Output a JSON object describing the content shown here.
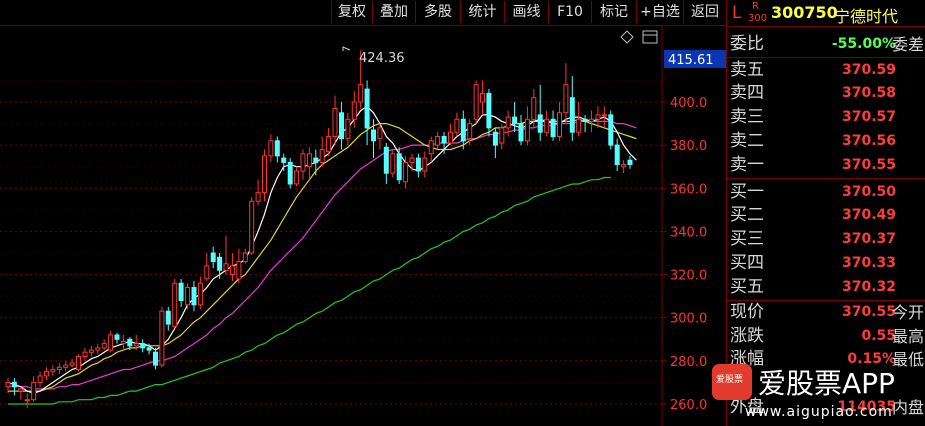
{
  "toolbar": {
    "buttons": [
      "复权",
      "叠加",
      "多股",
      "统计",
      "画线",
      "F10",
      "标记",
      "+自选",
      "返回"
    ]
  },
  "stock": {
    "market_tag": "L",
    "r_tag": "R",
    "index_tag": "300",
    "code": "300750",
    "name": "宁德时代"
  },
  "chart": {
    "high_marker": "424.36",
    "price_label": "415.61",
    "y_ticks": [
      "400.0",
      "380.0",
      "360.0",
      "340.0",
      "320.0",
      "300.0",
      "280.0",
      "260.0"
    ]
  },
  "chart_data": {
    "type": "candlestick",
    "y_tick_values": [
      400,
      380,
      360,
      340,
      320,
      300,
      280,
      260
    ],
    "high_annotation": 424.36,
    "candles": [
      [
        268,
        270,
        265,
        272
      ],
      [
        270,
        268,
        264,
        272
      ],
      [
        266,
        267,
        262,
        268
      ],
      [
        262,
        262,
        258,
        265
      ],
      [
        262,
        270,
        261,
        273
      ],
      [
        270,
        273,
        268,
        275
      ],
      [
        273,
        275,
        271,
        277
      ],
      [
        275,
        276,
        273,
        278
      ],
      [
        276,
        277,
        274,
        279
      ],
      [
        277,
        278,
        275,
        280
      ],
      [
        278,
        279,
        277,
        281
      ],
      [
        276,
        282,
        275,
        283
      ],
      [
        282,
        284,
        280,
        286
      ],
      [
        284,
        285,
        282,
        287
      ],
      [
        285,
        286,
        283,
        288
      ],
      [
        286,
        288,
        285,
        290
      ],
      [
        285,
        292,
        284,
        294
      ],
      [
        292,
        290,
        288,
        293
      ],
      [
        288,
        289,
        285,
        292
      ],
      [
        290,
        287,
        285,
        291
      ],
      [
        287,
        288,
        285,
        292
      ],
      [
        288,
        286,
        284,
        290
      ],
      [
        286,
        285,
        283,
        288
      ],
      [
        284,
        278,
        276,
        286
      ],
      [
        278,
        303,
        277,
        305
      ],
      [
        303,
        297,
        294,
        305
      ],
      [
        296,
        316,
        295,
        318
      ],
      [
        316,
        308,
        305,
        318
      ],
      [
        306,
        314,
        304,
        316
      ],
      [
        314,
        306,
        303,
        317
      ],
      [
        306,
        316,
        304,
        319
      ],
      [
        318,
        324,
        317,
        330
      ],
      [
        330,
        326,
        323,
        333
      ],
      [
        328,
        322,
        318,
        330
      ],
      [
        322,
        325,
        320,
        338
      ],
      [
        320,
        324,
        317,
        330
      ],
      [
        318,
        326,
        316,
        332
      ],
      [
        326,
        330,
        325,
        332
      ],
      [
        330,
        354,
        329,
        356
      ],
      [
        354,
        358,
        352,
        364
      ],
      [
        358,
        375,
        354,
        378
      ],
      [
        375,
        382,
        372,
        385
      ],
      [
        382,
        375,
        372,
        384
      ],
      [
        374,
        372,
        368,
        376
      ],
      [
        372,
        362,
        360,
        374
      ],
      [
        362,
        368,
        361,
        370
      ],
      [
        368,
        376,
        364,
        378
      ],
      [
        370,
        376,
        364,
        379
      ],
      [
        374,
        372,
        366,
        378
      ],
      [
        372,
        378,
        370,
        384
      ],
      [
        377,
        384,
        375,
        388
      ],
      [
        384,
        397,
        380,
        403
      ],
      [
        395,
        383,
        378,
        400
      ],
      [
        383,
        392,
        380,
        395
      ],
      [
        392,
        400,
        388,
        405
      ],
      [
        400,
        408,
        397,
        424
      ],
      [
        406,
        388,
        380,
        410
      ],
      [
        387,
        382,
        374,
        392
      ],
      [
        383,
        388,
        378,
        390
      ],
      [
        379,
        367,
        362,
        381
      ],
      [
        367,
        376,
        365,
        378
      ],
      [
        376,
        364,
        362,
        379
      ],
      [
        363,
        372,
        360,
        375
      ],
      [
        372,
        374,
        368,
        376
      ],
      [
        374,
        368,
        365,
        376
      ],
      [
        368,
        374,
        365,
        377
      ],
      [
        376,
        382,
        372,
        384
      ],
      [
        380,
        384,
        378,
        386
      ],
      [
        384,
        381,
        376,
        386
      ],
      [
        381,
        386,
        380,
        390
      ],
      [
        386,
        392,
        384,
        395
      ],
      [
        392,
        382,
        378,
        396
      ],
      [
        383,
        390,
        380,
        392
      ],
      [
        392,
        408,
        390,
        410
      ],
      [
        400,
        404,
        394,
        410
      ],
      [
        404,
        388,
        384,
        406
      ],
      [
        386,
        380,
        374,
        388
      ],
      [
        381,
        388,
        378,
        390
      ],
      [
        388,
        393,
        384,
        396
      ],
      [
        393,
        390,
        386,
        400
      ],
      [
        390,
        382,
        380,
        394
      ],
      [
        382,
        392,
        380,
        398
      ],
      [
        392,
        402,
        388,
        406
      ],
      [
        394,
        386,
        382,
        408
      ],
      [
        386,
        392,
        384,
        396
      ],
      [
        392,
        384,
        382,
        396
      ],
      [
        384,
        395,
        382,
        400
      ],
      [
        395,
        408,
        390,
        418
      ],
      [
        402,
        386,
        382,
        412
      ],
      [
        386,
        392,
        384,
        400
      ],
      [
        392,
        391,
        386,
        394
      ],
      [
        391,
        392,
        386,
        396
      ],
      [
        392,
        394,
        388,
        398
      ],
      [
        394,
        394,
        388,
        398
      ],
      [
        394,
        380,
        378,
        396
      ],
      [
        380,
        371,
        368,
        383
      ],
      [
        370,
        371,
        367,
        373
      ],
      [
        373,
        371,
        369,
        375
      ]
    ],
    "ma5": [
      270,
      269,
      268,
      266,
      265,
      266,
      268,
      270,
      272,
      274,
      276,
      277,
      279,
      281,
      282,
      284,
      286,
      287,
      288,
      289,
      288,
      288,
      287,
      285,
      287,
      290,
      295,
      300,
      306,
      309,
      311,
      314,
      318,
      320,
      322,
      324,
      325,
      327,
      333,
      340,
      348,
      358,
      365,
      370,
      371,
      370,
      370,
      371,
      372,
      374,
      376,
      381,
      386,
      388,
      392,
      396,
      398,
      395,
      390,
      384,
      381,
      376,
      372,
      369,
      368,
      370,
      372,
      375,
      378,
      381,
      384,
      386,
      388,
      390,
      394,
      394,
      393,
      391,
      390,
      389,
      388,
      389,
      391,
      392,
      391,
      390,
      390,
      392,
      393,
      393,
      392,
      391,
      392,
      393,
      391,
      386,
      380,
      376,
      373
    ],
    "ma10": [
      266,
      266,
      266,
      266,
      266,
      266,
      267,
      268,
      270,
      272,
      273,
      274,
      276,
      278,
      279,
      281,
      282,
      284,
      285,
      286,
      286,
      287,
      287,
      287,
      287,
      288,
      290,
      292,
      295,
      298,
      300,
      303,
      306,
      309,
      312,
      315,
      318,
      320,
      324,
      328,
      332,
      336,
      341,
      346,
      351,
      356,
      360,
      364,
      368,
      371,
      373,
      375,
      377,
      379,
      382,
      385,
      387,
      389,
      390,
      390,
      389,
      388,
      386,
      384,
      382,
      380,
      379,
      378,
      378,
      378,
      379,
      380,
      382,
      383,
      385,
      386,
      388,
      388,
      389,
      390,
      390,
      391,
      391,
      391,
      391,
      391,
      391,
      391,
      391,
      392,
      391,
      390,
      389,
      388,
      387,
      386,
      385,
      384,
      383
    ],
    "ma20": [
      268,
      268,
      268,
      268,
      267,
      267,
      267,
      267,
      268,
      268,
      269,
      269,
      270,
      271,
      272,
      273,
      274,
      275,
      276,
      276,
      277,
      278,
      279,
      280,
      280,
      281,
      282,
      284,
      286,
      288,
      290,
      292,
      295,
      297,
      300,
      302,
      305,
      308,
      311,
      314,
      318,
      322,
      325,
      328,
      331,
      334,
      337,
      341,
      345,
      349,
      353,
      357,
      360,
      363,
      366,
      369,
      371,
      373,
      375,
      377,
      378,
      378,
      379,
      380,
      380,
      380,
      380,
      381,
      381,
      381,
      381,
      382,
      383,
      383,
      384,
      385,
      385,
      386,
      386,
      387,
      387,
      388,
      388,
      389,
      389,
      389,
      390,
      390,
      390,
      391,
      391,
      391,
      391,
      391,
      391,
      390,
      390,
      389,
      388
    ],
    "ma60": [
      260,
      260,
      260,
      260,
      260,
      260,
      260,
      260,
      261,
      261,
      261,
      262,
      262,
      262,
      263,
      263,
      264,
      264,
      265,
      266,
      266,
      267,
      268,
      269,
      269,
      270,
      271,
      272,
      273,
      274,
      275,
      276,
      277,
      279,
      280,
      281,
      282,
      284,
      285,
      287,
      288,
      290,
      292,
      293,
      295,
      297,
      298,
      300,
      302,
      303,
      305,
      307,
      308,
      310,
      312,
      313,
      315,
      317,
      318,
      320,
      322,
      323,
      325,
      327,
      328,
      330,
      332,
      333,
      335,
      336,
      338,
      340,
      341,
      343,
      344,
      346,
      347,
      349,
      350,
      352,
      353,
      354,
      356,
      357,
      358,
      359,
      360,
      361,
      362,
      362,
      363,
      364,
      364,
      365,
      365
    ]
  },
  "panel": {
    "wei_bi": {
      "label": "委比",
      "value": "-55.00%",
      "extra": "委差"
    },
    "sells": [
      {
        "label": "卖五",
        "price": "370.59"
      },
      {
        "label": "卖四",
        "price": "370.58"
      },
      {
        "label": "卖三",
        "price": "370.57"
      },
      {
        "label": "卖二",
        "price": "370.56"
      },
      {
        "label": "卖一",
        "price": "370.55"
      }
    ],
    "buys": [
      {
        "label": "买一",
        "price": "370.50"
      },
      {
        "label": "买二",
        "price": "370.49"
      },
      {
        "label": "买三",
        "price": "370.37"
      },
      {
        "label": "买四",
        "price": "370.33"
      },
      {
        "label": "买五",
        "price": "370.32"
      }
    ],
    "quote": [
      {
        "label": "现价",
        "value": "370.55",
        "extra": "今开"
      },
      {
        "label": "涨跌",
        "value": "0.55",
        "extra": "最高"
      },
      {
        "label": "涨幅",
        "value": "0.15%",
        "extra": "最低"
      },
      {
        "label": "量",
        "value": "",
        "extra": ""
      },
      {
        "label": "外盘",
        "value": "114035",
        "extra": "内盘"
      }
    ]
  },
  "watermark": {
    "brand": "爱股票APP",
    "url": "www.aigupiao.com",
    "badge": "爱股票"
  },
  "colors": {
    "up": "#ff3232",
    "down": "#54ffff",
    "ma5": "#ffffff",
    "ma10": "#e6d52a",
    "ma20": "#e63ad6",
    "ma60": "#22c922",
    "grid": "#7a0000"
  }
}
